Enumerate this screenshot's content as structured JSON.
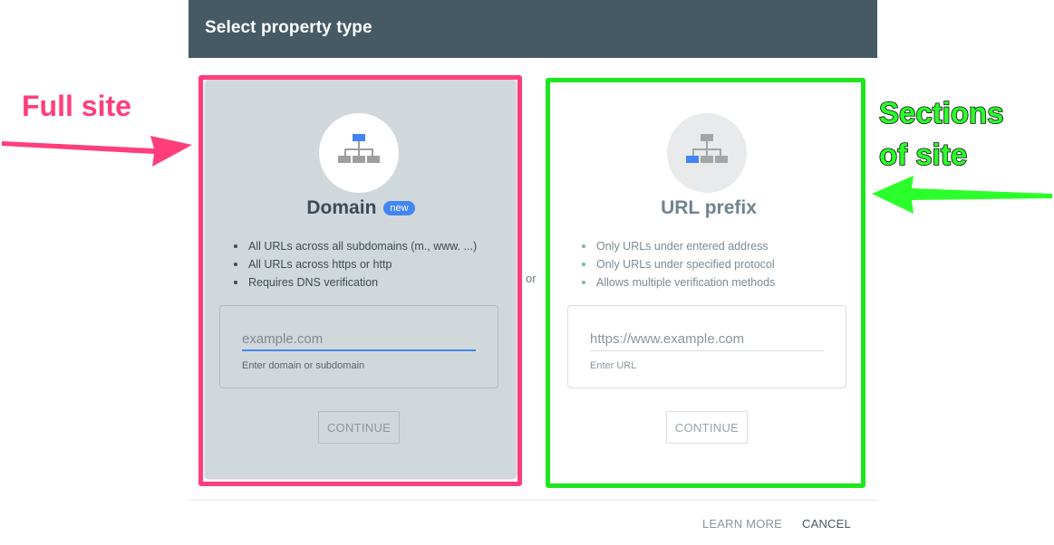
{
  "dialog": {
    "title": "Select property type"
  },
  "domain_card": {
    "icon": "sitemap-icon",
    "title": "Domain",
    "badge": "new",
    "bullets": [
      "All URLs across all subdomains (m., www. ...)",
      "All URLs across https or http",
      "Requires DNS verification"
    ],
    "input_placeholder": "example.com",
    "input_value": "",
    "input_helper": "Enter domain or subdomain",
    "button_label": "CONTINUE"
  },
  "separator": "or",
  "url_card": {
    "icon": "sitemap-icon",
    "title": "URL prefix",
    "bullets": [
      "Only URLs under entered address",
      "Only URLs under specified protocol",
      "Allows multiple verification methods"
    ],
    "input_placeholder": "https://www.example.com",
    "input_value": "",
    "input_helper": "Enter URL",
    "button_label": "CONTINUE"
  },
  "footer": {
    "learn_more_label": "LEARN MORE",
    "cancel_label": "CANCEL"
  },
  "annotations": {
    "full_site": "Full site",
    "sections_line1": "Sections",
    "sections_line2": "of site"
  },
  "colors": {
    "header_bg": "#455a64",
    "accent_blue": "#4285f4",
    "highlight_pink": "#ff3e7b",
    "highlight_green": "#1ee61e",
    "domain_card_bg": "#d1d8dc"
  }
}
